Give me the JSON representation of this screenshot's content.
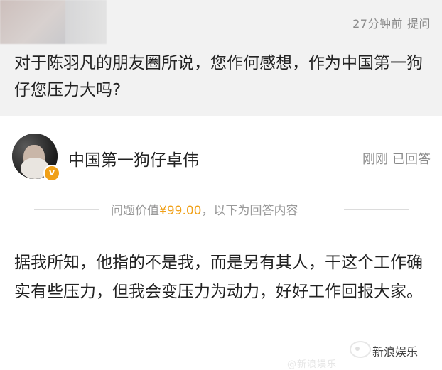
{
  "question": {
    "time": "27分钟前",
    "action": "提问",
    "text": "对于陈羽凡的朋友圈所说，您作何感想，作为中国第一狗仔您压力大吗?"
  },
  "answerer": {
    "name": "中国第一狗仔卓伟",
    "badge": "v",
    "time": "刚刚",
    "status": "已回答"
  },
  "price": {
    "prefix": "问题价值",
    "value": "¥99.00",
    "suffix": "，以下为回答内容"
  },
  "answer": {
    "text": "据我所知，他指的不是我，而是另有其人，干这个工作确实有些压力，但我会变压力为动力，好好工作回报大家。"
  },
  "watermark": {
    "handle": "@新浪娱乐",
    "brand": "新浪娱乐"
  },
  "colors": {
    "accent": "#f0a018",
    "question_bg": "#f2f2f2",
    "muted_text": "#8a8a8a"
  }
}
